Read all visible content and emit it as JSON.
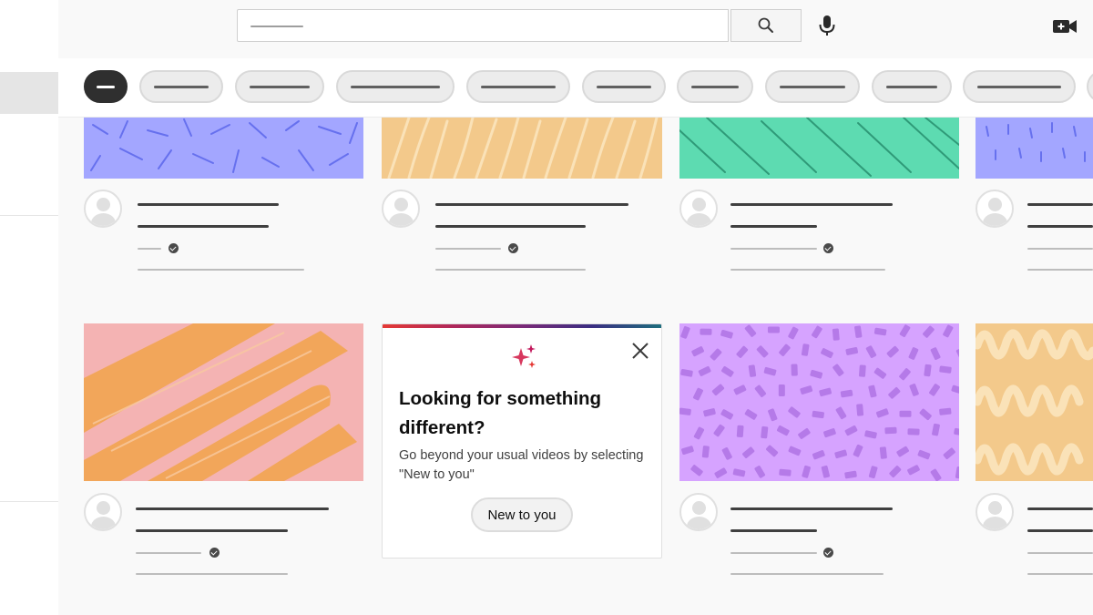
{
  "header": {
    "search_icon": "search-icon",
    "mic_icon": "microphone-icon",
    "create_icon": "video-camera-plus-icon"
  },
  "promo": {
    "title": "Looking for something different?",
    "body": "Go beyond your usual videos by selecting \"New to you\"",
    "button_label": "New to you",
    "sparkle_icon": "sparkle-icon",
    "close_icon": "close-icon"
  },
  "colors": {
    "thumb_blue": "#a3a6ff",
    "thumb_yellow": "#f3c98b",
    "thumb_green": "#5ddbb1",
    "thumb_pink": "#f4b3b3",
    "thumb_orange": "#f2a65a",
    "thumb_purple": "#d6a3ff",
    "thumb_purple_marks": "#b57ae8"
  }
}
